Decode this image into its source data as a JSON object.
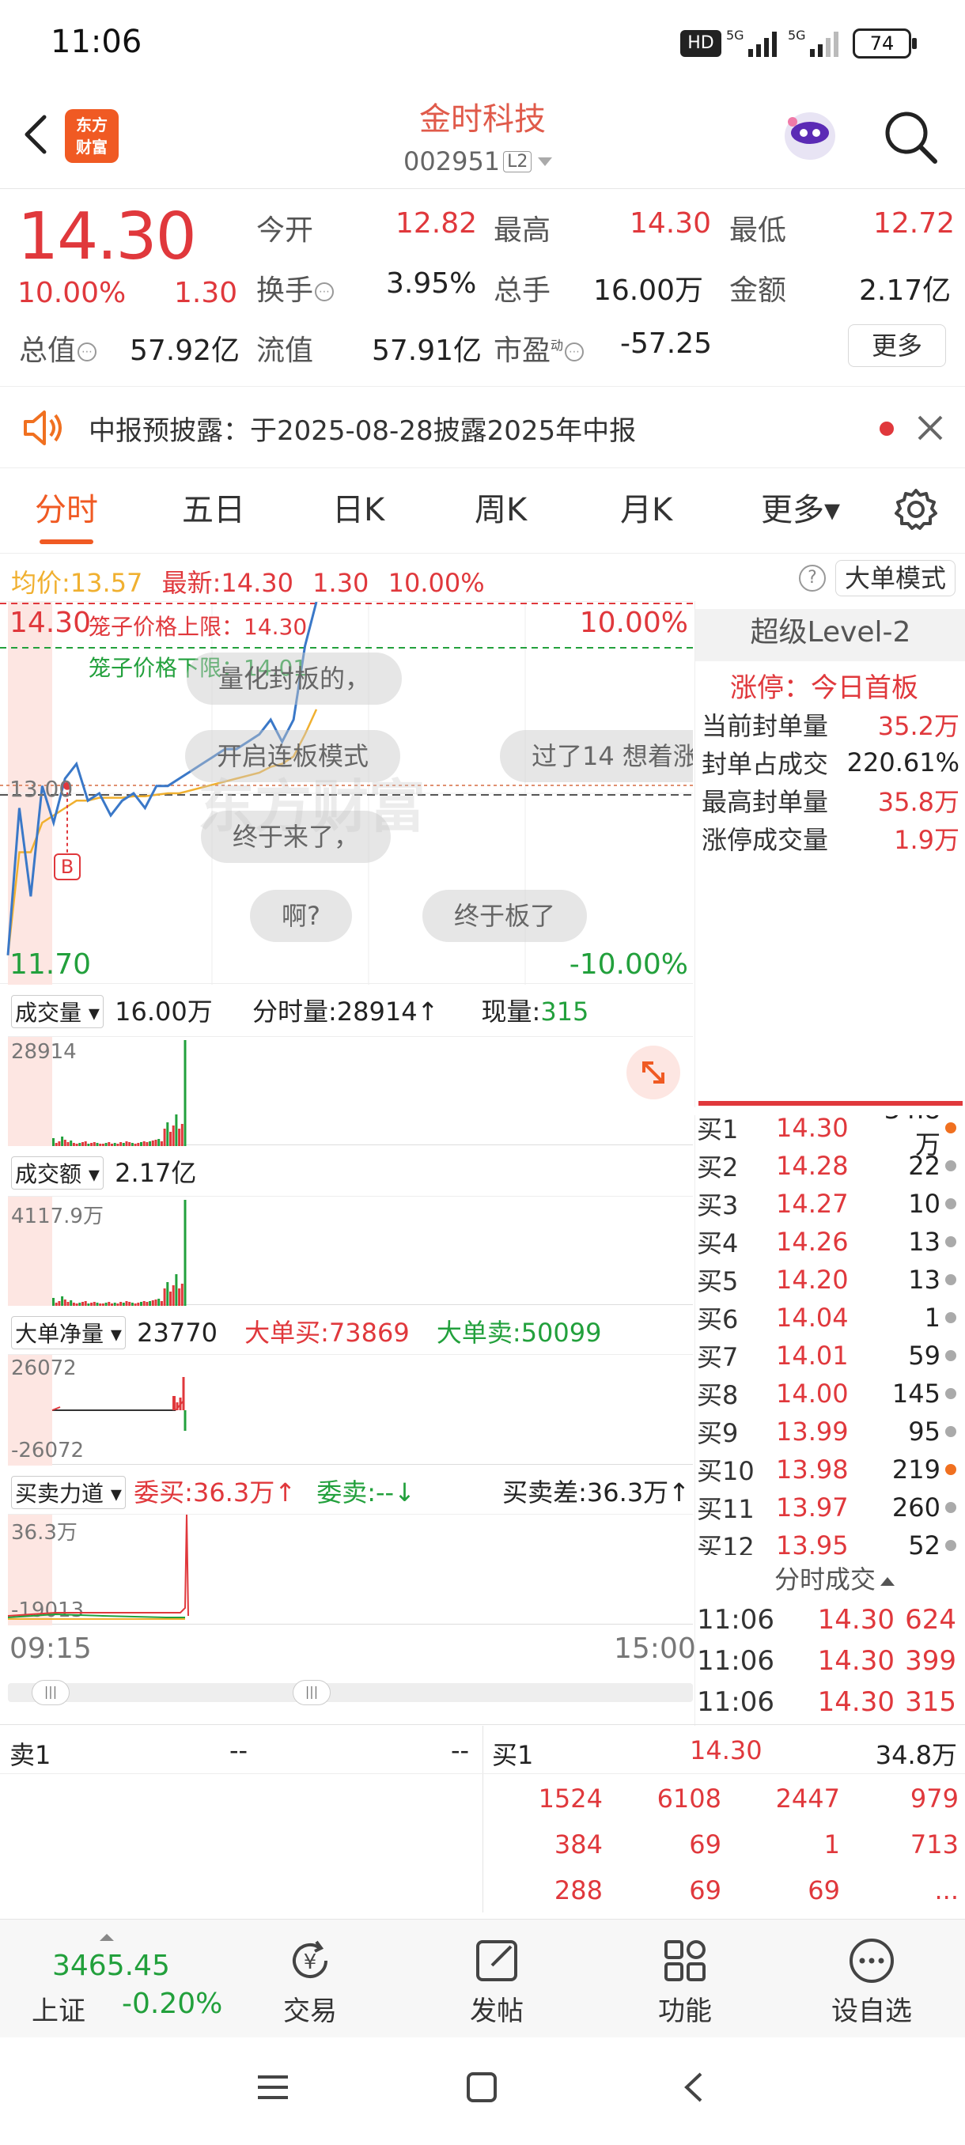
{
  "status_bar": {
    "time": "11:06",
    "battery": "74",
    "net1": "HD",
    "net2": "5G",
    "net3": "5G"
  },
  "header": {
    "app_logo_text": "东方\n财富",
    "title": "金时科技",
    "code": "002951",
    "level_badge": "L2"
  },
  "quote": {
    "price": "14.30",
    "pct": "10.00%",
    "chg": "1.30",
    "open_label": "今开",
    "open": "12.82",
    "high_label": "最高",
    "high": "14.30",
    "low_label": "最低",
    "low": "12.72",
    "turnover_label": "换手",
    "turnover": "3.95%",
    "volume_label": "总手",
    "volume": "16.00万",
    "amount_label": "金额",
    "amount": "2.17亿",
    "mcap_label": "总值",
    "mcap": "57.92亿",
    "float_label": "流值",
    "float_cap": "57.91亿",
    "pe_label": "市盈",
    "pe_sup": "动",
    "pe": "-57.25",
    "more_button": "更多"
  },
  "notice": {
    "text": "中报预披露：于2025-08-28披露2025年中报"
  },
  "tabs": [
    {
      "label": "分时",
      "active": true
    },
    {
      "label": "五日"
    },
    {
      "label": "日K"
    },
    {
      "label": "周K"
    },
    {
      "label": "月K"
    },
    {
      "label": "更多▾"
    }
  ],
  "chart_header": {
    "avg_label": "均价:",
    "avg": "13.57",
    "latest_label": "最新:",
    "latest": "14.30",
    "chg": "1.30",
    "pct": "10.00%",
    "mode_button": "大单模式"
  },
  "chart_labels": {
    "top_price": "14.30",
    "top_pct": "10.00%",
    "bottom_price": "11.70",
    "bottom_pct": "-10.00%",
    "cage_upper": "笼子价格上限：14.30",
    "cage_lower": "笼子价格下限：14.01",
    "mid_price": "13.00",
    "b_marker": "B",
    "watermark": "东方财富"
  },
  "bubbles": [
    "量化封板的，",
    "开启连板模式",
    "过了14 想着涨",
    "终于来了，",
    "啊?",
    "终于板了"
  ],
  "level2": {
    "title": "超级Level-2",
    "limit_label": "涨停：今日首板",
    "rows": [
      {
        "label": "当前封单量",
        "value": "35.2万"
      },
      {
        "label": "封单占成交",
        "value": "220.61%"
      },
      {
        "label": "最高封单量",
        "value": "35.8万"
      },
      {
        "label": "涨停成交量",
        "value": "1.9万"
      }
    ]
  },
  "volume_panel": {
    "label": "成交量",
    "total": "16.00万",
    "minute_label": "分时量:",
    "minute": "28914↑",
    "now_label": "现量:",
    "now": "315",
    "axis_max": "28914"
  },
  "amount_panel": {
    "label": "成交额",
    "total": "2.17亿",
    "axis_max": "4117.9万"
  },
  "bigorder_panel": {
    "label": "大单净量",
    "net": "23770",
    "buy_label": "大单买:",
    "buy": "73869",
    "sell_label": "大单卖:",
    "sell": "50099",
    "axis_max": "26072",
    "axis_min": "-26072"
  },
  "force_panel": {
    "label": "买卖力道",
    "bid_label": "委买:",
    "bid": "36.3万↑",
    "ask_label": "委卖:",
    "ask": "--↓",
    "diff_label": "买卖差:",
    "diff": "36.3万↑",
    "axis_max": "36.3万",
    "axis_min": "-19013"
  },
  "time_axis": {
    "start": "09:15",
    "end": "15:00"
  },
  "orderbook": [
    {
      "label": "买1",
      "price": "14.30",
      "vol": "34.8万",
      "dot": "#f07020"
    },
    {
      "label": "买2",
      "price": "14.28",
      "vol": "22",
      "dot": "#aaaaaa"
    },
    {
      "label": "买3",
      "price": "14.27",
      "vol": "10",
      "dot": "#aaaaaa"
    },
    {
      "label": "买4",
      "price": "14.26",
      "vol": "13",
      "dot": "#aaaaaa"
    },
    {
      "label": "买5",
      "price": "14.20",
      "vol": "13",
      "dot": "#aaaaaa"
    },
    {
      "label": "买6",
      "price": "14.04",
      "vol": "1",
      "dot": "#aaaaaa"
    },
    {
      "label": "买7",
      "price": "14.01",
      "vol": "59",
      "dot": "#aaaaaa"
    },
    {
      "label": "买8",
      "price": "14.00",
      "vol": "145",
      "dot": "#aaaaaa"
    },
    {
      "label": "买9",
      "price": "13.99",
      "vol": "95",
      "dot": "#aaaaaa"
    },
    {
      "label": "买10",
      "price": "13.98",
      "vol": "219",
      "dot": "#f07020"
    },
    {
      "label": "买11",
      "price": "13.97",
      "vol": "260",
      "dot": "#aaaaaa"
    },
    {
      "label": "买12",
      "price": "13.95",
      "vol": "52",
      "dot": "#aaaaaa"
    }
  ],
  "trades_title": "分时成交",
  "trades": [
    {
      "time": "11:06",
      "price": "14.30",
      "vol": "624"
    },
    {
      "time": "11:06",
      "price": "14.30",
      "vol": "399"
    },
    {
      "time": "11:06",
      "price": "14.30",
      "vol": "315"
    }
  ],
  "queue": {
    "sell_label": "卖1",
    "sell_price": "--",
    "sell_vol": "--",
    "buy_label": "买1",
    "buy_price": "14.30",
    "buy_vol": "34.8万",
    "rows": [
      [
        "1524",
        "6108",
        "2447",
        "979"
      ],
      [
        "384",
        "69",
        "1",
        "713"
      ],
      [
        "288",
        "69",
        "69",
        "..."
      ]
    ]
  },
  "bottom_nav": {
    "index_value": "3465.45",
    "index_name": "上证",
    "index_pct": "-0.20%",
    "items": [
      {
        "label": "交易",
        "icon": "yuan-icon"
      },
      {
        "label": "发帖",
        "icon": "edit-icon"
      },
      {
        "label": "功能",
        "icon": "grid-icon"
      },
      {
        "label": "设自选",
        "icon": "more-icon"
      }
    ]
  },
  "colors": {
    "up": "#e0383c",
    "down": "#22a03c",
    "accent": "#f07020",
    "avg_line": "#f0b030",
    "price_line": "#3a78c8"
  },
  "chart_data": {
    "type": "line",
    "x": [
      0,
      10,
      20,
      30,
      40,
      50,
      60,
      70,
      80,
      90,
      100,
      110,
      120,
      130,
      140,
      150,
      160,
      170,
      180,
      190,
      200,
      210,
      220,
      230,
      240,
      250,
      260,
      270
    ],
    "series": [
      {
        "values": [
          11.9,
          12.9,
          12.3,
          13.05,
          12.8,
          13.1,
          13.2,
          12.95,
          13.0,
          12.85,
          12.95,
          13.0,
          12.9,
          13.05,
          13.05,
          13.1,
          13.15,
          13.2,
          13.25,
          13.3,
          13.3,
          13.35,
          13.4,
          13.5,
          13.35,
          13.5,
          14.0,
          14.3
        ]
      },
      {
        "values": [
          11.9,
          12.6,
          12.6,
          12.8,
          12.85,
          12.9,
          12.95,
          12.95,
          12.97,
          12.97,
          12.97,
          12.98,
          12.98,
          12.99,
          13.0,
          13.0,
          13.02,
          13.04,
          13.06,
          13.08,
          13.1,
          13.12,
          13.14,
          13.18,
          13.2,
          13.25,
          13.4,
          13.57
        ]
      }
    ],
    "ylim": [
      11.7,
      14.3
    ],
    "ref": 13.0
  }
}
